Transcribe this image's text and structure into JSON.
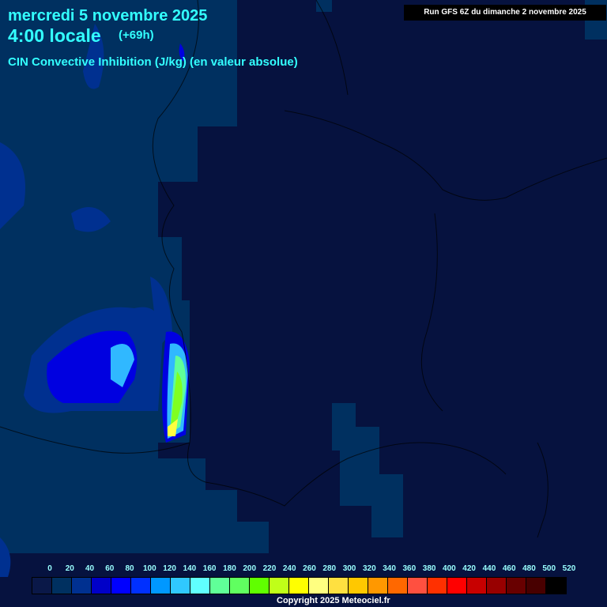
{
  "header": {
    "date": "mercredi 5 novembre 2025",
    "local_time": "4:00 locale",
    "forecast_offset": "(+69h)",
    "parameter": "CIN Convective Inhibition (J/kg) (en valeur absolue)",
    "run": "Run GFS 6Z du dimanche 2 novembre 2025"
  },
  "legend": {
    "labels": [
      "0",
      "20",
      "40",
      "60",
      "80",
      "100",
      "120",
      "140",
      "160",
      "180",
      "200",
      "220",
      "240",
      "260",
      "280",
      "300",
      "320",
      "340",
      "360",
      "380",
      "400",
      "420",
      "440",
      "460",
      "480",
      "500",
      "520"
    ],
    "colors": [
      "#0a1848",
      "#003060",
      "#003090",
      "#0000c8",
      "#0000ff",
      "#0030ff",
      "#0098ff",
      "#30c8ff",
      "#60ffff",
      "#60ff98",
      "#60ff60",
      "#60ff00",
      "#c0ff18",
      "#ffff00",
      "#ffff80",
      "#ffe040",
      "#ffc800",
      "#ff9800",
      "#ff6800",
      "#ff5040",
      "#ff3000",
      "#ff0000",
      "#c80000",
      "#980000",
      "#680000",
      "#480000",
      "#000000"
    ]
  },
  "copyright": "Copyright 2025 Meteociel.fr"
}
